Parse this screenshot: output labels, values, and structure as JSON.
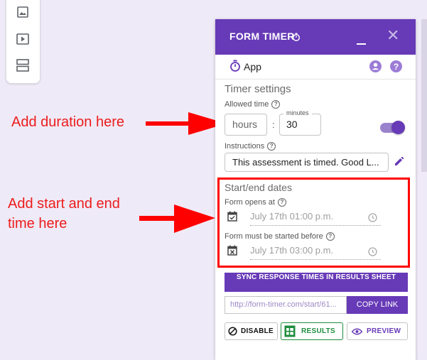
{
  "toolbar": {
    "items": [
      "image-icon",
      "video-icon",
      "section-icon"
    ]
  },
  "annotations": {
    "duration": "Add duration here",
    "dates_line1": "Add start and end",
    "dates_line2": "time here"
  },
  "panel": {
    "title": "FORM TIMER",
    "app_label": "App",
    "timer_settings": "Timer settings",
    "allowed_time_label": "Allowed time",
    "hours_placeholder": "hours",
    "minutes_label": "minutes",
    "minutes_value": "30",
    "separator": ":",
    "instructions_label": "Instructions",
    "instructions_value": "This assessment is timed. Good L...",
    "start_end_title": "Start/end dates",
    "opens_label": "Form opens at",
    "opens_value": "July 17th 01:00 p.m.",
    "started_before_label": "Form must be started before",
    "started_before_value": "July 17th 03:00 p.m.",
    "sync_button": "SYNC RESPONSE TIMES IN RESULTS SHEET",
    "url": "http://form-timer.com/start/61...",
    "copy_link": "COPY LINK",
    "disable": "DISABLE",
    "results": "RESULTS",
    "preview": "PREVIEW"
  },
  "colors": {
    "brand": "#673ab7",
    "annotation": "#ff0000",
    "results_green": "#1e8e3e"
  }
}
